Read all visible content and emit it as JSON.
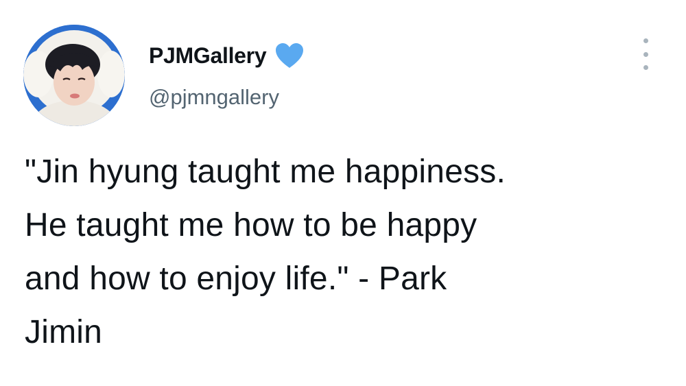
{
  "tweet": {
    "display_name": "PJMGallery",
    "handle": "@pjmngallery",
    "verified_icon": "heart-icon",
    "verified_color": "#5aa9f0",
    "more_icon": "more-vertical-icon",
    "text": "\"Jin hyung taught me happiness.\nHe taught me how to be happy\nand how to enjoy life.\" - Park\nJimin"
  }
}
